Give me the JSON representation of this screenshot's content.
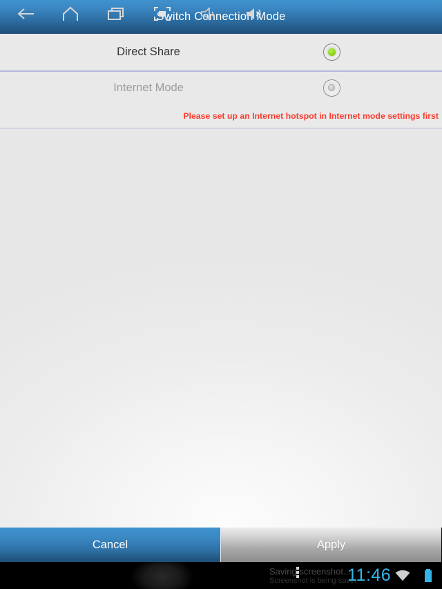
{
  "titlebar": {
    "title": "Switch Connection Mode"
  },
  "options": [
    {
      "label": "Direct Share",
      "state": "selected",
      "enabled": true,
      "radio_icon": "radio-selected-icon"
    },
    {
      "label": "Internet Mode",
      "state": "unselected",
      "enabled": false,
      "radio_icon": "radio-unselected-icon"
    }
  ],
  "warning": {
    "text": "Please set up an Internet hotspot in Internet mode settings first",
    "color": "#fb3b2e"
  },
  "buttons": {
    "cancel_label": "Cancel",
    "apply_label": "Apply"
  },
  "navbar": {
    "icons": [
      "back-icon",
      "home-icon",
      "recents-icon",
      "screenshot-icon",
      "volume-down-icon",
      "volume-up-icon"
    ],
    "notification": {
      "title": "Saving screenshot...",
      "subtitle": "Screenshot is being saved.",
      "overflow_icon": "more-vertical-icon"
    },
    "clock": "11:46",
    "wifi_icon": "wifi-icon",
    "battery_icon": "battery-full-icon",
    "accent_color": "#33b5e5"
  },
  "theme": {
    "title_blue": "#3f92ce",
    "divider": "#b6b6e0",
    "radio_on": "#8ed41c"
  }
}
